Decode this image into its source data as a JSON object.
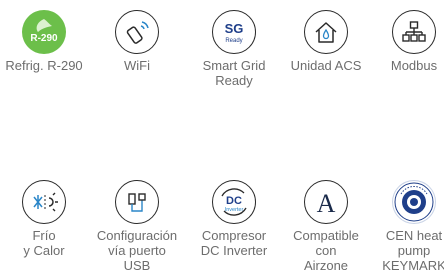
{
  "row1": [
    {
      "label": "Refrig. R-290",
      "icon": "r290-leaf-icon",
      "badge": "R-290"
    },
    {
      "label": "WiFi",
      "icon": "wifi-phone-icon"
    },
    {
      "label": "Smart Grid\nReady",
      "icon": "smart-grid-icon",
      "badge": "SG",
      "badge_sub": "Ready"
    },
    {
      "label": "Unidad ACS",
      "icon": "house-water-drop-icon"
    },
    {
      "label": "Modbus",
      "icon": "network-hierarchy-icon"
    }
  ],
  "row2": [
    {
      "label": "Frío\ny Calor",
      "icon": "cold-heat-icon"
    },
    {
      "label": "Configuración\nvía puerto\nUSB",
      "icon": "usb-icon"
    },
    {
      "label": "Compresor\nDC Inverter",
      "icon": "dc-inverter-icon",
      "badge": "DC",
      "badge_sub": "Inverter"
    },
    {
      "label": "Compatible\ncon\nAirzone",
      "icon": "airzone-icon",
      "badge": "A"
    },
    {
      "label": "CEN heat\npump\nKEYMARK",
      "icon": "keymark-seal-icon"
    }
  ],
  "colors": {
    "green": "#6cbf4a",
    "accent_blue": "#2a86c8",
    "navy": "#1f3f8a",
    "text": "#6d6d6d"
  }
}
